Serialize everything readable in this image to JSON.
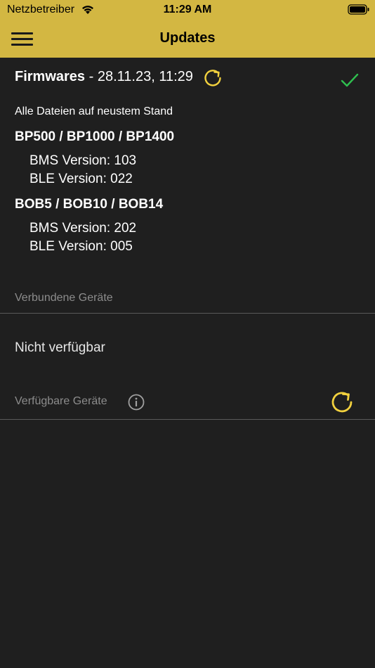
{
  "status_bar": {
    "carrier": "Netzbetreiber",
    "time": "11:29 AM",
    "wifi_icon": "wifi-icon",
    "battery_icon": "battery-icon"
  },
  "nav": {
    "title": "Updates",
    "menu_icon": "hamburger-menu-icon"
  },
  "firmwares": {
    "label": "Firmwares",
    "separator": " - ",
    "date": "28.11.23, 11:29",
    "status_message": "Alle Dateien auf neustem Stand",
    "refresh_icon": "refresh-icon",
    "status_icon": "checkmark-icon",
    "groups": [
      {
        "title": "BP500 / BP1000 / BP1400",
        "versions": [
          "BMS Version: 103",
          "BLE Version: 022"
        ]
      },
      {
        "title": "BOB5 / BOB10 / BOB14",
        "versions": [
          "BMS Version: 202",
          "BLE Version: 005"
        ]
      }
    ]
  },
  "connected_devices": {
    "label": "Verbundene Geräte",
    "empty_text": "Nicht verfügbar"
  },
  "available_devices": {
    "label": "Verfügbare Geräte",
    "info_icon": "info-icon",
    "refresh_icon": "refresh-icon"
  },
  "colors": {
    "header": "#d3b742",
    "background": "#1f1f1f",
    "accent": "#f2d13e",
    "success": "#2fbf4f",
    "muted_text": "#8c8c8c",
    "divider": "#5a5a5a"
  }
}
